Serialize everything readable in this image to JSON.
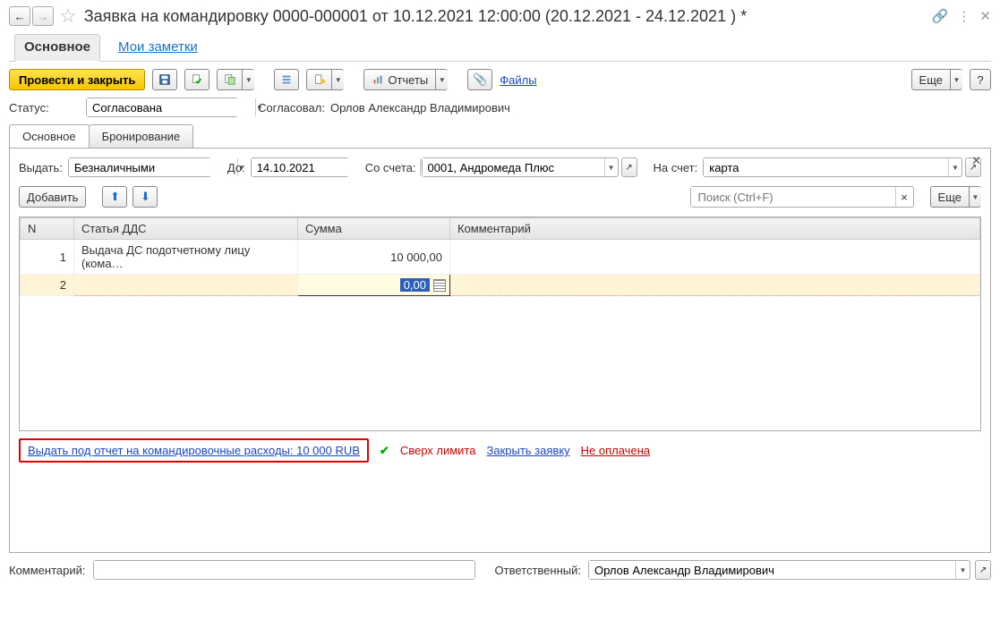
{
  "header": {
    "title": "Заявка на командировку 0000-000001 от 10.12.2021 12:00:00 (20.12.2021 - 24.12.2021 ) *"
  },
  "page_tabs": {
    "main": "Основное",
    "notes": "Мои заметки"
  },
  "toolbar": {
    "post_close": "Провести и закрыть",
    "reports": "Отчеты",
    "files": "Файлы",
    "more": "Еще",
    "help": "?"
  },
  "status_row": {
    "status_label": "Статус:",
    "status_value": "Согласована",
    "approved_label": "Согласовал:",
    "approved_value": "Орлов Александр Владимирович"
  },
  "inner_tabs": {
    "main": "Основное",
    "booking": "Бронирование"
  },
  "payout": {
    "give_label": "Выдать:",
    "give_value": "Безналичными",
    "before_label": "До:",
    "before_value": "14.10.2021",
    "from_acc_label": "Со счета:",
    "from_acc_value": "0001, Андромеда Плюс",
    "to_acc_label": "На счет:",
    "to_acc_value": "карта"
  },
  "add_button": "Добавить",
  "search_placeholder": "Поиск (Ctrl+F)",
  "more2": "Еще",
  "table": {
    "col_n": "N",
    "col_dds": "Статья ДДС",
    "col_sum": "Сумма",
    "col_comment": "Комментарий",
    "rows": [
      {
        "n": "1",
        "dds": "Выдача ДС подотчетному лицу (кома…",
        "sum": "10 000,00",
        "comment": ""
      },
      {
        "n": "2",
        "dds": "",
        "sum": "0,00",
        "comment": ""
      }
    ]
  },
  "bottom": {
    "link": "Выдать под отчет на командировочные расходы: 10 000 RUB",
    "over_limit": "Сверх лимита",
    "close_request": "Закрыть заявку",
    "not_paid": "Не оплачена"
  },
  "footer": {
    "comment_label": "Комментарий:",
    "resp_label": "Ответственный:",
    "resp_value": "Орлов Александр Владимирович"
  }
}
